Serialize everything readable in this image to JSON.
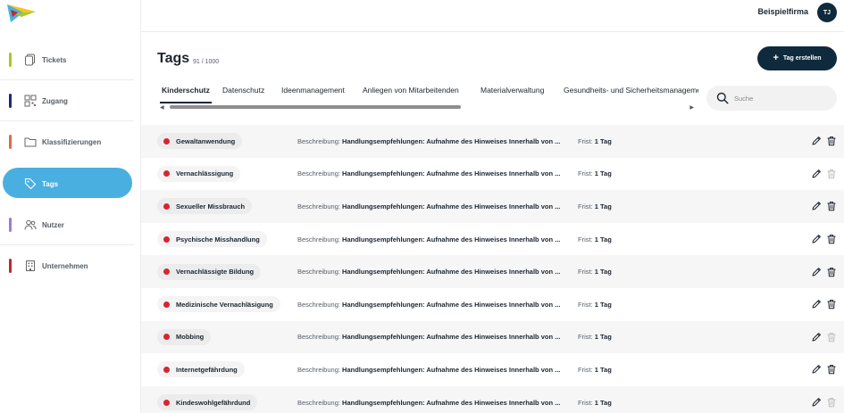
{
  "header": {
    "company": "Beispielfirma",
    "avatar_initials": "TJ"
  },
  "sidebar": {
    "items": [
      {
        "label": "Tickets",
        "icon": "tickets-icon",
        "color": "#a9c827"
      },
      {
        "label": "Zugang",
        "icon": "qr-code-icon",
        "color": "#1e2a78"
      },
      {
        "label": "Klassifizierungen",
        "icon": "folder-icon",
        "color": "#e06a4a"
      },
      {
        "label": "Tags",
        "icon": "tag-icon",
        "color": "#49afe0",
        "active": true
      },
      {
        "label": "Nutzer",
        "icon": "users-icon",
        "color": "#9b7ecb"
      },
      {
        "label": "Unternehmen",
        "icon": "building-icon",
        "color": "#c0282d"
      }
    ]
  },
  "page": {
    "title": "Tags",
    "count": "91 / 1000",
    "create_label": "Tag erstellen"
  },
  "tabs": [
    "Kinderschutz",
    "Datenschutz",
    "Ideenmanagement",
    "Anliegen von Mitarbeitenden",
    "Materialverwaltung",
    "Gesundheits- und Sicherheitsmanagement"
  ],
  "search": {
    "placeholder": "Suche"
  },
  "rows": [
    {
      "name": "Gewaltanwendung",
      "desc_label": "Beschreibung:",
      "desc": "Handlungsempfehlungen: Aufnahme des Hinweises Innerhalb von ...",
      "frist_label": "Frist:",
      "frist": "1 Tag",
      "trash_disabled": false
    },
    {
      "name": "Vernachlässigung",
      "desc_label": "Beschreibung:",
      "desc": "Handlungsempfehlungen: Aufnahme des Hinweises Innerhalb von ...",
      "frist_label": "Frist:",
      "frist": "1 Tag",
      "trash_disabled": true
    },
    {
      "name": "Sexueller Missbrauch",
      "desc_label": "Beschreibung:",
      "desc": "Handlungsempfehlungen: Aufnahme des Hinweises Innerhalb von ...",
      "frist_label": "Frist:",
      "frist": "1 Tag",
      "trash_disabled": false
    },
    {
      "name": "Psychische Misshandlung",
      "desc_label": "Beschreibung:",
      "desc": "Handlungsempfehlungen: Aufnahme des Hinweises Innerhalb von ...",
      "frist_label": "Frist:",
      "frist": "1 Tag",
      "trash_disabled": false
    },
    {
      "name": "Vernachlässigte Bildung",
      "desc_label": "Beschreibung:",
      "desc": "Handlungsempfehlungen: Aufnahme des Hinweises Innerhalb von ...",
      "frist_label": "Frist:",
      "frist": "1 Tag",
      "trash_disabled": false
    },
    {
      "name": "Medizinische Vernachläsigung",
      "desc_label": "Beschreibung:",
      "desc": "Handlungsempfehlungen: Aufnahme des Hinweises Innerhalb von ...",
      "frist_label": "Frist:",
      "frist": "1 Tag",
      "trash_disabled": false
    },
    {
      "name": "Mobbing",
      "desc_label": "Beschreibung:",
      "desc": "Handlungsempfehlungen: Aufnahme des Hinweises Innerhalb von ...",
      "frist_label": "Frist:",
      "frist": "1 Tag",
      "trash_disabled": true
    },
    {
      "name": "Internetgefährdung",
      "desc_label": "Beschreibung:",
      "desc": "Handlungsempfehlungen: Aufnahme des Hinweises Innerhalb von ...",
      "frist_label": "Frist:",
      "frist": "1 Tag",
      "trash_disabled": false
    },
    {
      "name": "Kindeswohlgefährdund",
      "desc_label": "Beschreibung:",
      "desc": "Handlungsempfehlungen: Aufnahme des Hinweises Innerhalb von ...",
      "frist_label": "Frist:",
      "frist": "1 Tag",
      "trash_disabled": true
    }
  ]
}
